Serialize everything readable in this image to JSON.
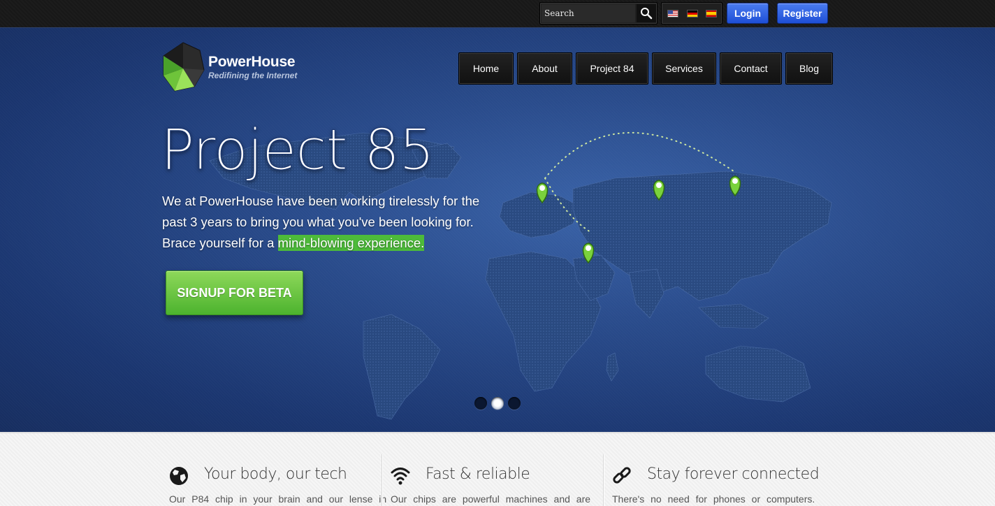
{
  "topbar": {
    "search_placeholder": "Search",
    "login_label": "Login",
    "register_label": "Register"
  },
  "brand": {
    "name": "PowerHouse",
    "tagline": "Redifining the Internet"
  },
  "nav": [
    {
      "label": "Home"
    },
    {
      "label": "About"
    },
    {
      "label": "Project 84"
    },
    {
      "label": "Services"
    },
    {
      "label": "Contact"
    },
    {
      "label": "Blog"
    }
  ],
  "hero": {
    "title": "Project 85",
    "text_main": "We at PowerHouse have been working tirelessly for the past 3 years to bring you what you've been looking for. Brace yourself for a ",
    "text_highlight": "mind-blowing experience.",
    "cta_label": "SIGNUP FOR BETA",
    "slider_dots": 3,
    "active_slide": 2
  },
  "features": [
    {
      "icon": "globe-icon",
      "title": "Your body, our tech",
      "text": "Our P84 chip in your brain and our lense in"
    },
    {
      "icon": "wifi-icon",
      "title": "Fast & reliable",
      "text": "Our chips are powerful machines and are"
    },
    {
      "icon": "link-icon",
      "title": "Stay forever connected",
      "text": "There's no need for phones or computers."
    }
  ],
  "colors": {
    "hero_blue": "#1b3670",
    "accent_green": "#5cc33e",
    "button_blue": "#2a5ae0"
  }
}
